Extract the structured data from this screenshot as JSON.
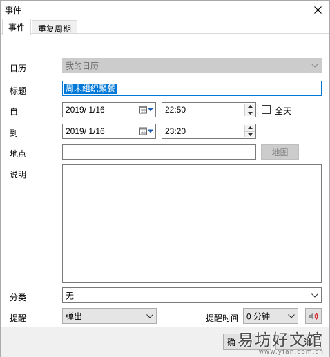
{
  "window": {
    "title": "事件",
    "close_glyph": "✕"
  },
  "tabs": [
    {
      "label": "事件",
      "active": true
    },
    {
      "label": "重复周期",
      "active": false
    }
  ],
  "form": {
    "calendar": {
      "label": "日历",
      "value": "我的日历",
      "disabled": true
    },
    "title": {
      "label": "标题",
      "value": "周末组织聚餐"
    },
    "from": {
      "label": "自",
      "date": "2019/  1/16",
      "time": "22:50"
    },
    "to": {
      "label": "到",
      "date": "2019/  1/16",
      "time": "23:20"
    },
    "all_day": {
      "label": "全天",
      "checked": false
    },
    "location": {
      "label": "地点",
      "value": "",
      "map_button": "地图",
      "map_disabled": true
    },
    "description": {
      "label": "说明",
      "value": ""
    },
    "category": {
      "label": "分类",
      "value": "无"
    },
    "reminder": {
      "label": "提醒",
      "value": "弹出"
    },
    "reminder_time": {
      "label": "提醒时间",
      "value": "0 分钟"
    }
  },
  "buttons": {
    "ok": "确",
    "cancel": "消"
  },
  "watermark": {
    "main": "易坊好文馆",
    "sub": "www.yfan.com.cn"
  },
  "colors": {
    "accent": "#0078d7",
    "disabled_bg": "#cccccc",
    "speaker_red": "#d9262a"
  },
  "icons": {
    "close": "close-icon",
    "calendar_picker": "calendar-icon",
    "dropdown": "chevron-down-icon",
    "spin_up": "arrow-up-icon",
    "spin_down": "arrow-down-icon",
    "sound": "speaker-icon"
  }
}
